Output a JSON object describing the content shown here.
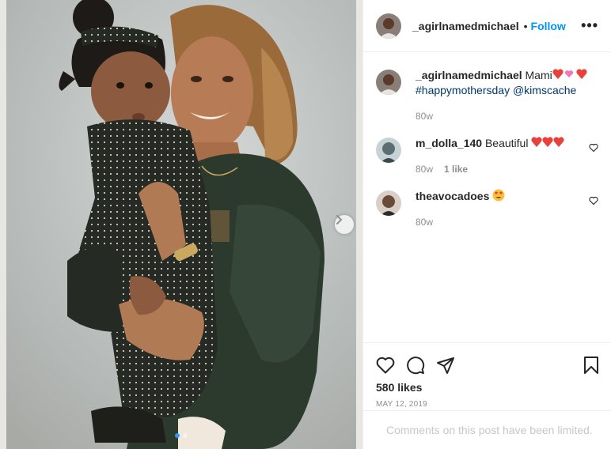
{
  "post": {
    "image_alt": "Photo of a woman holding a toddler",
    "carousel_total": 2,
    "carousel_index": 1
  },
  "header": {
    "username": "_agirlnamedmichael",
    "separator": "•",
    "follow_label": "Follow",
    "more_label": "•••"
  },
  "caption": {
    "username": "_agirlnamedmichael",
    "text": "Mami",
    "hashtag": "#happymothersday",
    "mention": "@kimscache",
    "time": "80w"
  },
  "comments": [
    {
      "username": "m_dolla_140",
      "text": "Beautiful",
      "time": "80w",
      "likes": "1 like"
    },
    {
      "username": "theavocadoes",
      "text": "",
      "time": "80w"
    }
  ],
  "engagement": {
    "likes": "580 likes",
    "date": "MAY 12, 2019"
  },
  "footer": {
    "limited_text": "Comments on this post have been limited."
  },
  "colors": {
    "link_blue": "#0095f6",
    "heart_red": "#e8413c",
    "muted": "#8e8e8e"
  }
}
